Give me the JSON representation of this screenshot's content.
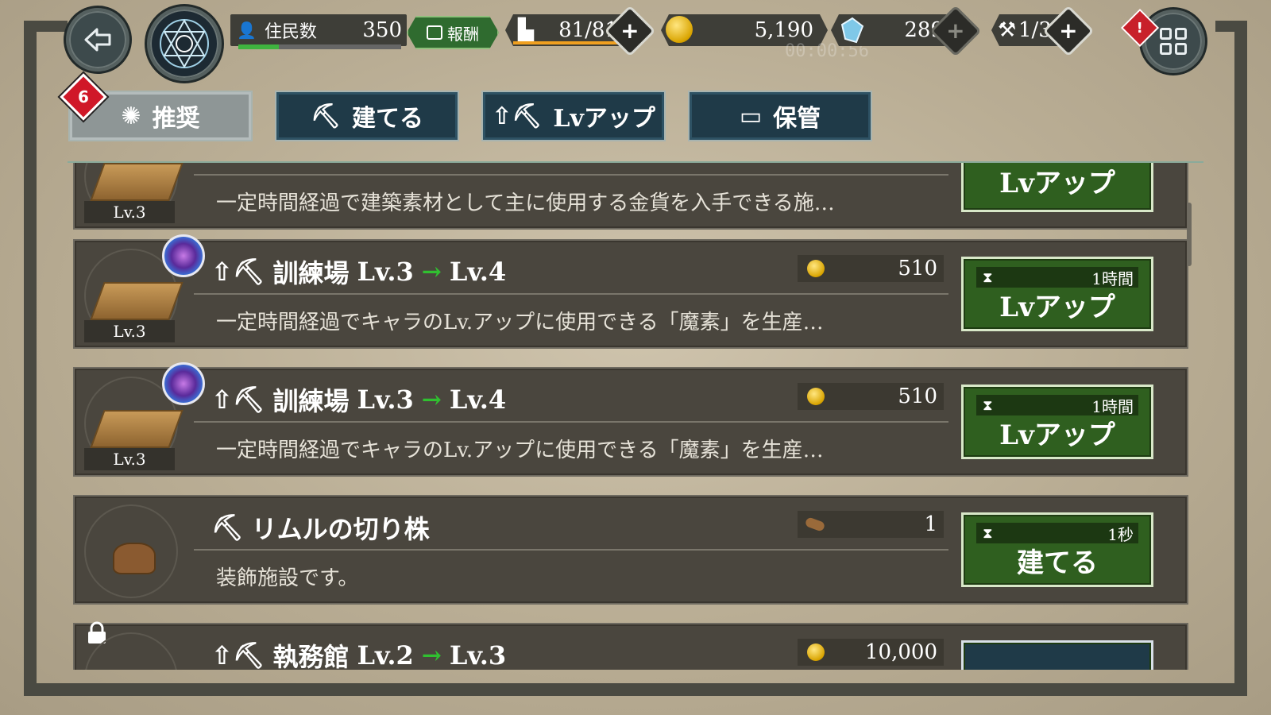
{
  "header": {
    "population_label": "住民数",
    "population_value": "350",
    "population_fill": 0.25,
    "reward_label": "報酬",
    "stamina_value": "81/81",
    "gold_value": "5,190",
    "crystal_value": "289",
    "tickets_value": "1/3",
    "timer_text": "00:00:56",
    "alert_mark": "!"
  },
  "tabs": [
    {
      "label": "推奨",
      "active": true
    },
    {
      "label": "建てる",
      "active": false
    },
    {
      "label": "Lvアップ",
      "active": false
    },
    {
      "label": "保管",
      "active": false
    }
  ],
  "tab_badge": "6",
  "list": {
    "rows": [
      {
        "level": "Lv.3",
        "title": "",
        "description": "一定時間経過で建築素材として主に使用する金貨を入手できる施…",
        "action_label": "Lvアップ",
        "action_time": ""
      },
      {
        "level": "Lv.3",
        "title_name": "訓練場",
        "title_from": "Lv.3",
        "title_to": "Lv.4",
        "cost": "510",
        "description": "一定時間経過でキャラのLv.アップに使用できる「魔素」を生産…",
        "action_label": "Lvアップ",
        "action_time": "1時間"
      },
      {
        "level": "Lv.3",
        "title_name": "訓練場",
        "title_from": "Lv.3",
        "title_to": "Lv.4",
        "cost": "510",
        "description": "一定時間経過でキャラのLv.アップに使用できる「魔素」を生産…",
        "action_label": "Lvアップ",
        "action_time": "1時間"
      },
      {
        "title_name": "リムルの切り株",
        "cost": "1",
        "description": "装飾施設です。",
        "action_label": "建てる",
        "action_time": "1秒"
      },
      {
        "title_name": "執務館",
        "title_from": "Lv.2",
        "title_to": "Lv.3",
        "cost": "10,000"
      }
    ]
  },
  "colors": {
    "action_green": "#2f5f1f",
    "tab_blue": "#1f3a48",
    "alert_red": "#c8202a"
  }
}
